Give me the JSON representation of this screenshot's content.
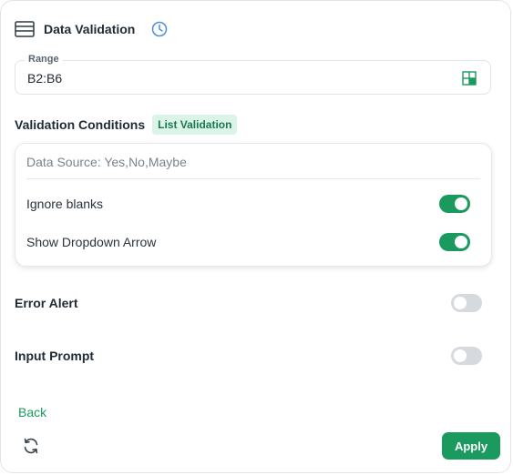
{
  "header": {
    "title": "Data Validation",
    "icon": "spreadsheet-icon",
    "history_icon": "clock-icon"
  },
  "range": {
    "label": "Range",
    "value": "B2:B6",
    "picker_icon": "cell-grid-icon"
  },
  "validation": {
    "label": "Validation Conditions",
    "badge": "List Validation",
    "source": "Data Source: Yes,No,Maybe",
    "options": [
      {
        "label": "Ignore blanks",
        "enabled": true
      },
      {
        "label": "Show Dropdown Arrow",
        "enabled": true
      }
    ]
  },
  "error_alert": {
    "label": "Error Alert",
    "enabled": false
  },
  "input_prompt": {
    "label": "Input Prompt",
    "enabled": false
  },
  "footer": {
    "back_label": "Back",
    "apply_label": "Apply",
    "refresh_icon": "refresh-icon"
  },
  "colors": {
    "accent": "#1a9a5e",
    "badge_bg": "#dcf3e8",
    "toggle_off": "#d6d9dd"
  }
}
